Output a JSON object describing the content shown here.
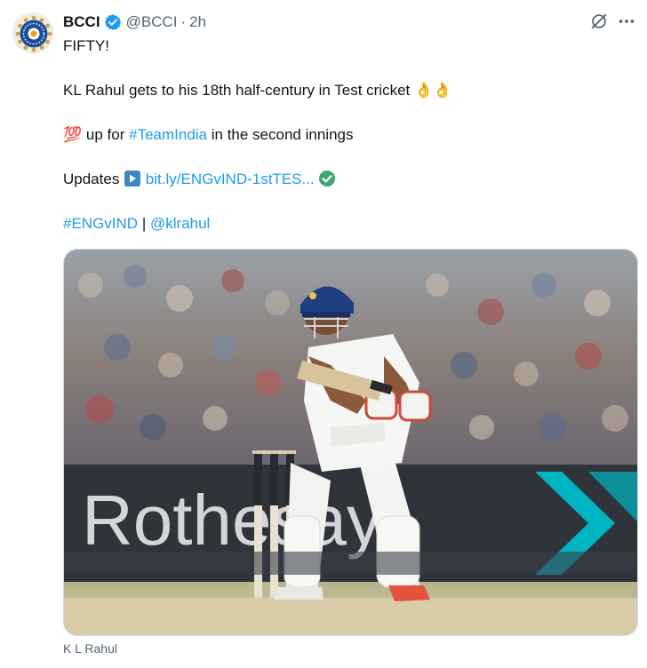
{
  "tweet": {
    "author_name": "BCCI",
    "handle": "@BCCI",
    "separator": "·",
    "time": "2h",
    "lines": {
      "line1": "FIFTY!",
      "line2_text": "KL Rahul gets to his 18th half-century in Test cricket",
      "line3_prefix": "up for",
      "line3_hashtag": "#TeamIndia",
      "line3_suffix": "in the second innings",
      "line4_prefix": "Updates",
      "line4_link": "bit.ly/ENGvIND-1stTES...",
      "line5_tag1": "#ENGvIND",
      "line5_sep": "|",
      "line5_tag2": "@klrahul"
    },
    "emojis": {
      "ok_hand": "👌",
      "hundred": "💯",
      "play": "▶",
      "check": "✅"
    },
    "media": {
      "ad_board_text": "Rothesay",
      "stump_brand": "Rothesay",
      "caption": "K L Rahul"
    },
    "icons": [
      "verified-badge-icon",
      "grok-icon",
      "more-icon"
    ]
  },
  "colors": {
    "link": "#1d9bf0",
    "secondary_text": "#536471",
    "verified": "#1d9bf0",
    "ad_board": "#2f333a",
    "ad_chevron": "#00b5c3"
  }
}
